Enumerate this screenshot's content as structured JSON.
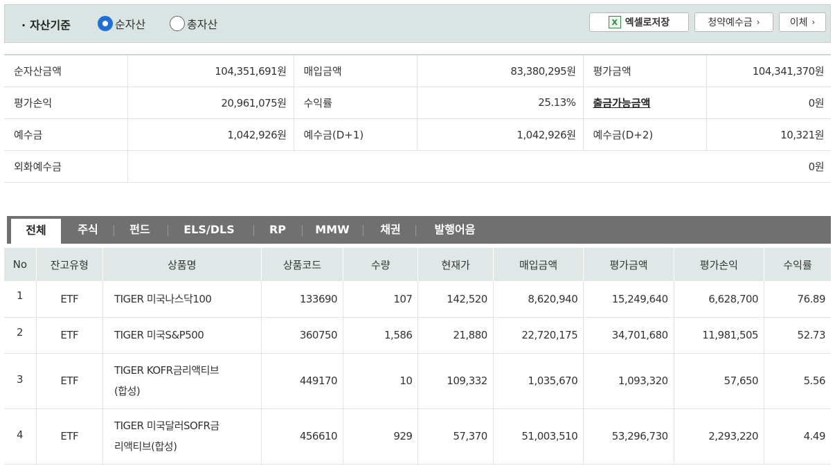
{
  "topbar": {
    "title": "자산기준",
    "radio_options": [
      {
        "label": "순자산",
        "selected": true
      },
      {
        "label": "총자산",
        "selected": false
      }
    ],
    "excel_button": "엑셀로저장",
    "excel_icon_text": "X",
    "subscription_button": "청약예수금",
    "transfer_button": "이체",
    "chevron": "›"
  },
  "summary": {
    "rows": [
      [
        {
          "label": "순자산금액",
          "value": "104,351,691원"
        },
        {
          "label": "매입금액",
          "value": "83,380,295원"
        },
        {
          "label": "평가금액",
          "value": "104,341,370원"
        }
      ],
      [
        {
          "label": "평가손익",
          "value": "20,961,075원"
        },
        {
          "label": "수익률",
          "value": "25.13%"
        },
        {
          "label": "출금가능금액",
          "value": "0원"
        }
      ],
      [
        {
          "label": "예수금",
          "value": "1,042,926원"
        },
        {
          "label": "예수금(D+1)",
          "value": "1,042,926원"
        },
        {
          "label": "예수금(D+2)",
          "value": "10,321원"
        }
      ]
    ],
    "foreign": {
      "label": "외화예수금",
      "value": "0원"
    }
  },
  "tabs": [
    "전체",
    "주식",
    "펀드",
    "ELS/DLS",
    "RP",
    "MMW",
    "채권",
    "발행어음"
  ],
  "active_tab": "전체",
  "holdings": {
    "headers": [
      "No",
      "잔고유형",
      "상품명",
      "상품코드",
      "수량",
      "현재가",
      "매입금액",
      "평가금액",
      "평가손익",
      "수익률"
    ],
    "rows": [
      {
        "no": "1",
        "type": "ETF",
        "name1": "TIGER 미국나스닥100",
        "name2": "",
        "code": "133690",
        "qty": "107",
        "price": "142,520",
        "buy": "8,620,940",
        "eval": "15,249,640",
        "pl": "6,628,700",
        "rate": "76.89"
      },
      {
        "no": "2",
        "type": "ETF",
        "name1": "TIGER 미국S&P500",
        "name2": "",
        "code": "360750",
        "qty": "1,586",
        "price": "21,880",
        "buy": "22,720,175",
        "eval": "34,701,680",
        "pl": "11,981,505",
        "rate": "52.73"
      },
      {
        "no": "3",
        "type": "ETF",
        "name1": "TIGER KOFR금리액티브",
        "name2": "(합성)",
        "code": "449170",
        "qty": "10",
        "price": "109,332",
        "buy": "1,035,670",
        "eval": "1,093,320",
        "pl": "57,650",
        "rate": "5.56"
      },
      {
        "no": "4",
        "type": "ETF",
        "name1": "TIGER 미국달러SOFR금",
        "name2": "리액티브(합성)",
        "code": "456610",
        "qty": "929",
        "price": "57,370",
        "buy": "51,003,510",
        "eval": "53,296,730",
        "pl": "2,293,220",
        "rate": "4.49"
      }
    ]
  },
  "colors": {
    "profit": "#e0141e",
    "tab_bar": "#707070",
    "header_bg": "#dfe8e7",
    "topbar_bg": "#d9e4e3"
  }
}
